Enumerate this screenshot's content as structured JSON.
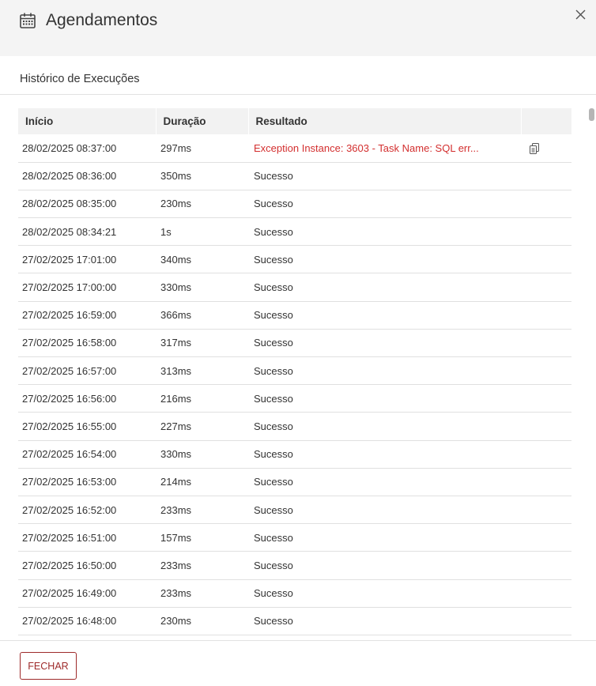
{
  "header": {
    "title": "Agendamentos",
    "icon": "calendar-icon",
    "close_icon": "close-icon"
  },
  "section": {
    "title": "Histórico de Execuções"
  },
  "table": {
    "columns": [
      "Início",
      "Duração",
      "Resultado",
      ""
    ],
    "rows": [
      {
        "start": "28/02/2025 08:37:00",
        "duration": "297ms",
        "result": "Exception Instance: 3603 - Task Name: SQL err...",
        "status": "error",
        "action_icon": "copy-icon"
      },
      {
        "start": "28/02/2025 08:36:00",
        "duration": "350ms",
        "result": "Sucesso",
        "status": "ok"
      },
      {
        "start": "28/02/2025 08:35:00",
        "duration": "230ms",
        "result": "Sucesso",
        "status": "ok"
      },
      {
        "start": "28/02/2025 08:34:21",
        "duration": "1s",
        "result": "Sucesso",
        "status": "ok"
      },
      {
        "start": "27/02/2025 17:01:00",
        "duration": "340ms",
        "result": "Sucesso",
        "status": "ok"
      },
      {
        "start": "27/02/2025 17:00:00",
        "duration": "330ms",
        "result": "Sucesso",
        "status": "ok"
      },
      {
        "start": "27/02/2025 16:59:00",
        "duration": "366ms",
        "result": "Sucesso",
        "status": "ok"
      },
      {
        "start": "27/02/2025 16:58:00",
        "duration": "317ms",
        "result": "Sucesso",
        "status": "ok"
      },
      {
        "start": "27/02/2025 16:57:00",
        "duration": "313ms",
        "result": "Sucesso",
        "status": "ok"
      },
      {
        "start": "27/02/2025 16:56:00",
        "duration": "216ms",
        "result": "Sucesso",
        "status": "ok"
      },
      {
        "start": "27/02/2025 16:55:00",
        "duration": "227ms",
        "result": "Sucesso",
        "status": "ok"
      },
      {
        "start": "27/02/2025 16:54:00",
        "duration": "330ms",
        "result": "Sucesso",
        "status": "ok"
      },
      {
        "start": "27/02/2025 16:53:00",
        "duration": "214ms",
        "result": "Sucesso",
        "status": "ok"
      },
      {
        "start": "27/02/2025 16:52:00",
        "duration": "233ms",
        "result": "Sucesso",
        "status": "ok"
      },
      {
        "start": "27/02/2025 16:51:00",
        "duration": "157ms",
        "result": "Sucesso",
        "status": "ok"
      },
      {
        "start": "27/02/2025 16:50:00",
        "duration": "233ms",
        "result": "Sucesso",
        "status": "ok"
      },
      {
        "start": "27/02/2025 16:49:00",
        "duration": "233ms",
        "result": "Sucesso",
        "status": "ok"
      },
      {
        "start": "27/02/2025 16:48:00",
        "duration": "230ms",
        "result": "Sucesso",
        "status": "ok"
      }
    ]
  },
  "footer": {
    "close_label": "FECHAR"
  },
  "colors": {
    "header_bg": "#f4f4f4",
    "error_text": "#d32f2f",
    "button_accent": "#9e2a2a"
  }
}
